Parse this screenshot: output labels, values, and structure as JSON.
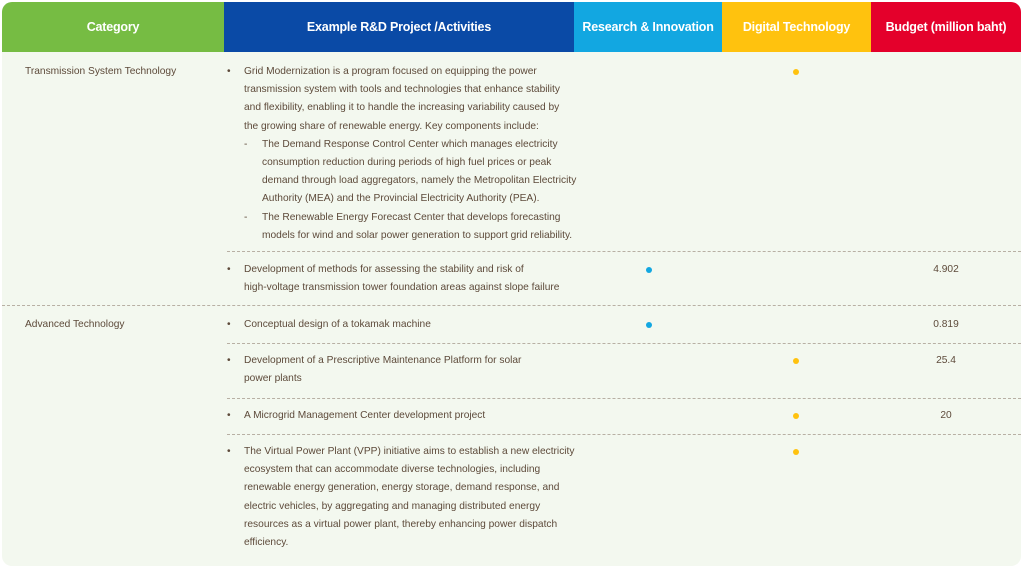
{
  "header": {
    "category": "Category",
    "example": "Example R&D Project /Activities",
    "research": "Research & Innovation",
    "digital": "Digital Technology",
    "budget": "Budget (million baht)"
  },
  "colors": {
    "green": "#76bc43",
    "navy": "#0a4aa6",
    "blue": "#12a7e1",
    "yellow": "#ffc20e",
    "red": "#e4002b",
    "text": "#5d4a3a",
    "bg": "#f3f8ef"
  },
  "rows": [
    {
      "category": "Transmission System Technology",
      "projects": [
        {
          "lines": [
            "Grid Modernization is a program focused on equipping the power",
            "transmission system with tools and technologies that enhance stability",
            "and flexibility, enabling it to handle the increasing variability caused by",
            "the growing share of renewable energy. Key components include:"
          ],
          "subitems": [
            {
              "lines": [
                "The Demand Response Control Center which manages electricity",
                "consumption reduction during periods of high fuel prices or peak",
                "demand through load aggregators, namely the Metropolitan Electricity",
                "Authority (MEA) and the Provincial Electricity Authority (PEA)."
              ]
            },
            {
              "lines": [
                "The Renewable Energy Forecast Center that develops forecasting",
                "models for wind and solar power generation to support grid reliability."
              ]
            }
          ],
          "marker": "digital",
          "budget": ""
        },
        {
          "lines": [
            "Development of methods for assessing the stability and risk of",
            "high-voltage transmission tower foundation areas against slope failure"
          ],
          "marker": "research",
          "budget": "4.902"
        }
      ]
    },
    {
      "category": "Advanced Technology",
      "projects": [
        {
          "lines": [
            "Conceptual design of a tokamak machine"
          ],
          "marker": "research",
          "budget": "0.819"
        },
        {
          "lines": [
            "Development of a Prescriptive Maintenance Platform for solar",
            "power plants"
          ],
          "marker": "digital",
          "budget": "25.4"
        },
        {
          "lines": [
            "A Microgrid Management Center development project"
          ],
          "marker": "digital",
          "budget": "20"
        },
        {
          "lines": [
            "The Virtual Power Plant (VPP) initiative aims to establish a new electricity",
            "ecosystem that can accommodate diverse technologies, including",
            "renewable energy generation, energy storage, demand response, and",
            "electric vehicles, by aggregating and managing distributed energy",
            "resources as a virtual power plant, thereby enhancing power dispatch",
            "efficiency."
          ],
          "marker": "digital",
          "budget": ""
        }
      ]
    }
  ]
}
